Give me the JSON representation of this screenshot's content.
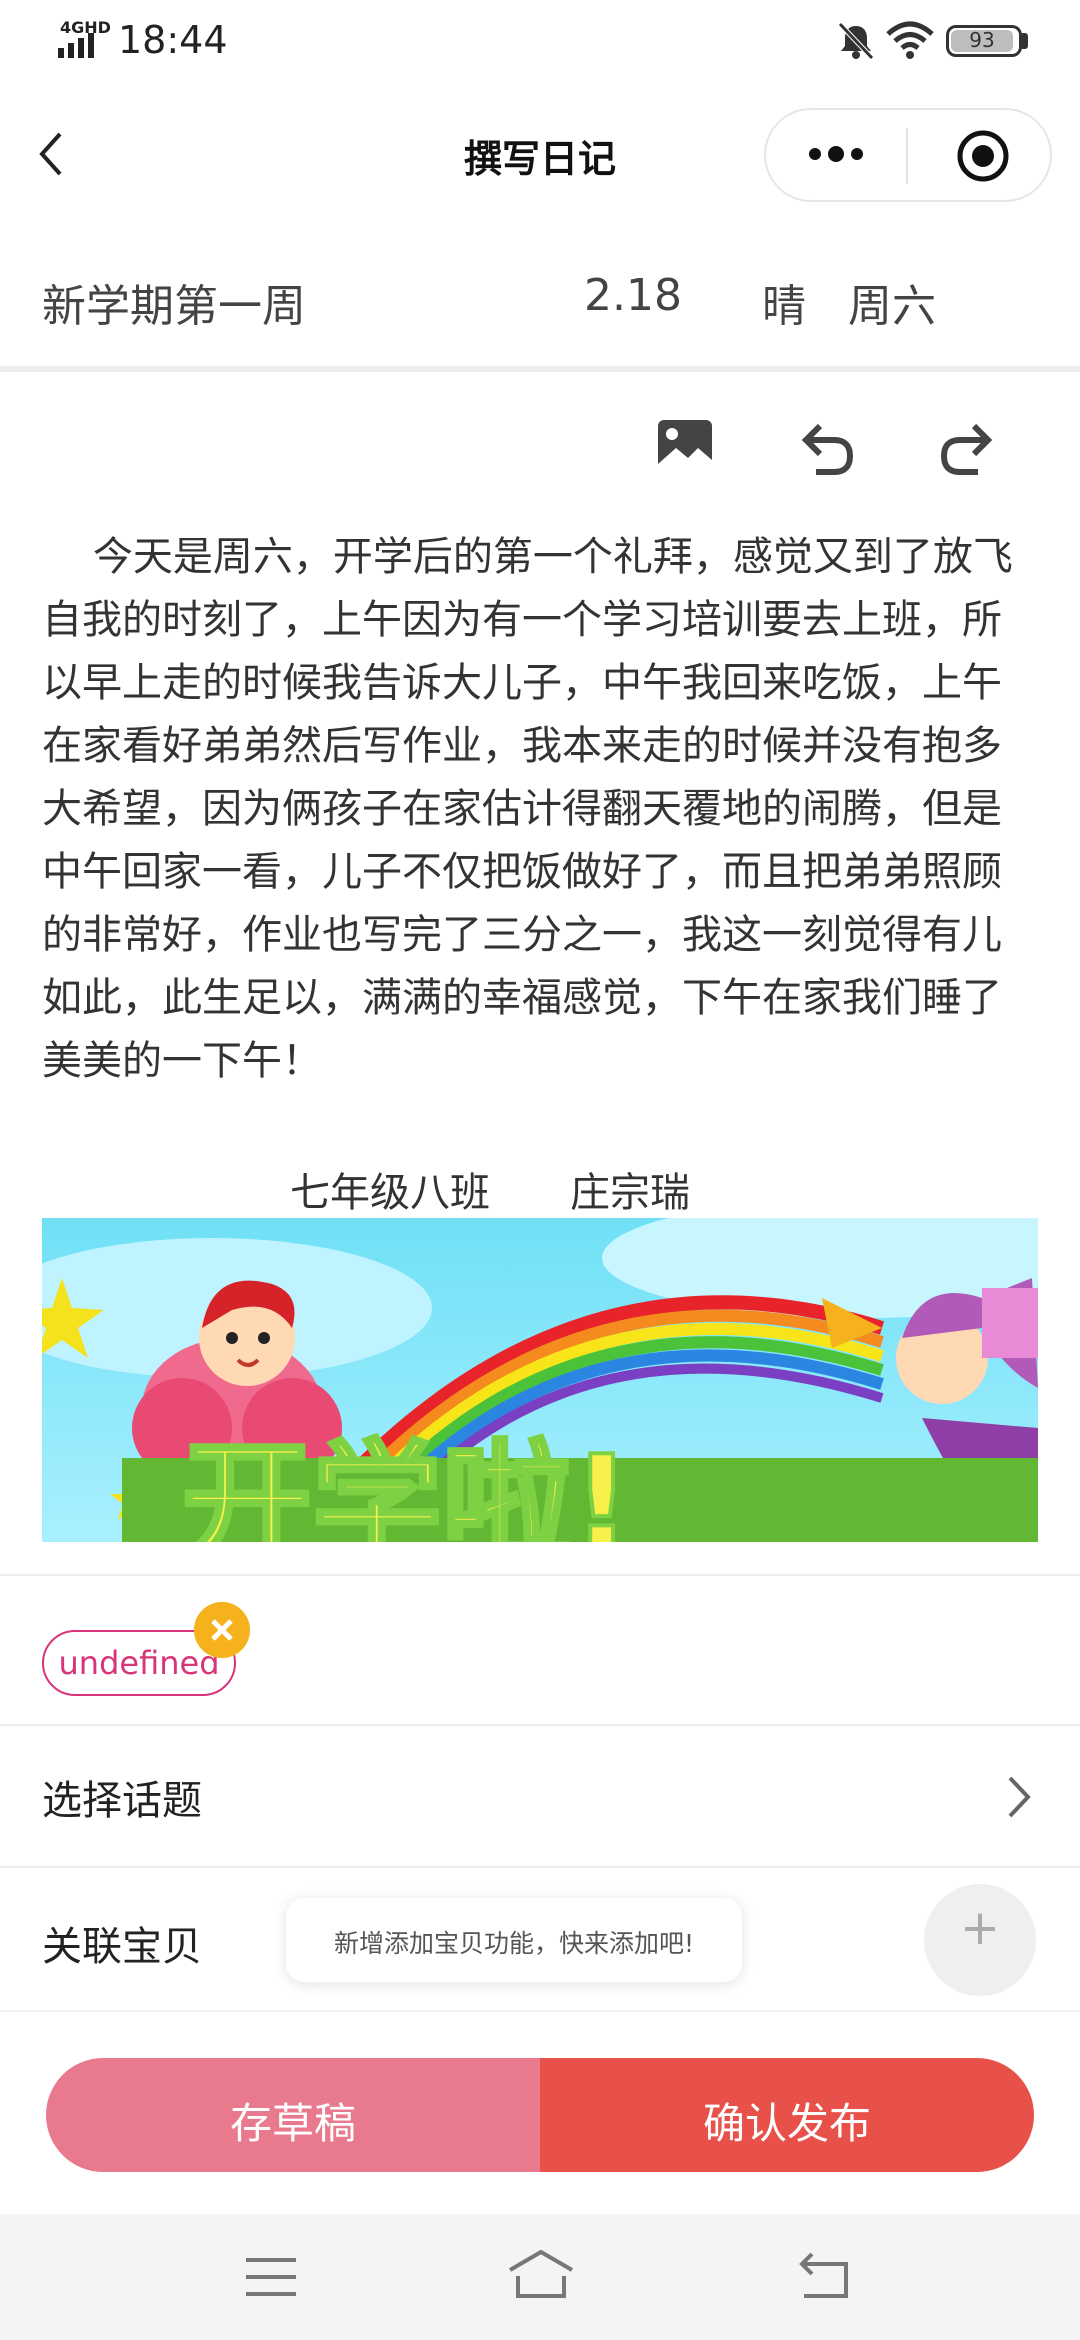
{
  "status_bar": {
    "network": "4GHD",
    "time": "18:44",
    "battery": "93"
  },
  "nav": {
    "title": "撰写日记"
  },
  "diary": {
    "title": "新学期第一周",
    "date": "2.18",
    "weather": "晴",
    "weekday": "周六",
    "body": "    今天是周六，开学后的第一个礼拜，感觉又到了放飞自我的时刻了，上午因为有一个学习培训要去上班，所以早上走的时候我告诉大儿子，中午我回来吃饭，上午在家看好弟弟然后写作业，我本来走的时候并没有抱多大希望，因为俩孩子在家估计得翻天覆地的闹腾，但是中午回家一看，儿子不仅把饭做好了，而且把弟弟照顾的非常好，作业也写完了三分之一，我这一刻觉得有儿如此，此生足以，满满的幸福感觉，下午在家我们睡了美美的一下午！",
    "sign_class": "七年级八班",
    "sign_name": "庄宗瑞",
    "banner_text": "开学啦!"
  },
  "tag": {
    "label": "undefined"
  },
  "topic": {
    "label": "选择话题"
  },
  "relate": {
    "label": "关联宝贝",
    "tooltip": "新增添加宝贝功能，快来添加吧!",
    "plus": "+"
  },
  "buttons": {
    "draft": "存草稿",
    "publish": "确认发布"
  },
  "colors": {
    "draft": "#e97a8e",
    "publish": "#e8514a",
    "tag": "#d6357a",
    "tag_close": "#f6b21d"
  },
  "icons": [
    "signal-icon",
    "bell-off-icon",
    "wifi-icon",
    "battery-icon",
    "back-icon",
    "more-icon",
    "close-target-icon",
    "image-icon",
    "undo-icon",
    "redo-icon",
    "chevron-right-icon",
    "plus-icon",
    "menu-icon",
    "home-icon",
    "return-icon"
  ]
}
